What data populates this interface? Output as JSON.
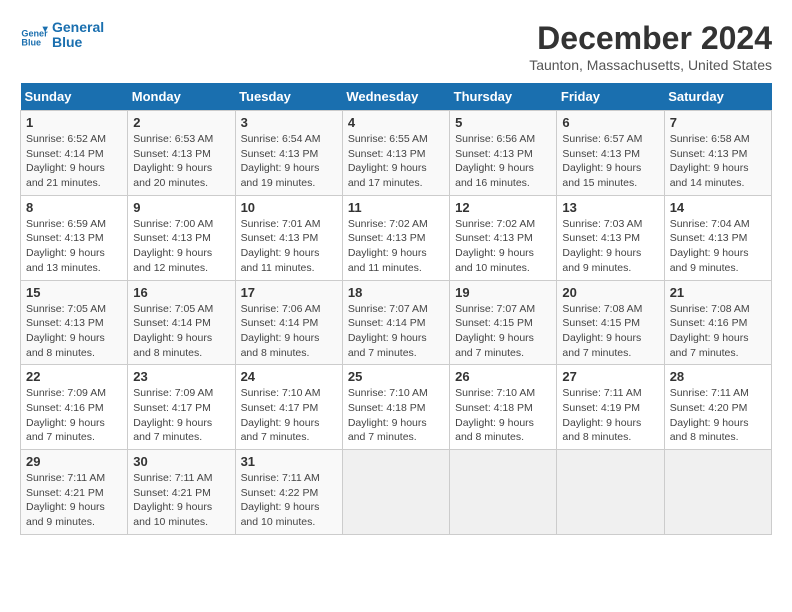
{
  "logo": {
    "line1": "General",
    "line2": "Blue"
  },
  "title": "December 2024",
  "subtitle": "Taunton, Massachusetts, United States",
  "days_of_week": [
    "Sunday",
    "Monday",
    "Tuesday",
    "Wednesday",
    "Thursday",
    "Friday",
    "Saturday"
  ],
  "weeks": [
    [
      {
        "day": "1",
        "sunrise": "6:52 AM",
        "sunset": "4:14 PM",
        "daylight": "9 hours and 21 minutes."
      },
      {
        "day": "2",
        "sunrise": "6:53 AM",
        "sunset": "4:13 PM",
        "daylight": "9 hours and 20 minutes."
      },
      {
        "day": "3",
        "sunrise": "6:54 AM",
        "sunset": "4:13 PM",
        "daylight": "9 hours and 19 minutes."
      },
      {
        "day": "4",
        "sunrise": "6:55 AM",
        "sunset": "4:13 PM",
        "daylight": "9 hours and 17 minutes."
      },
      {
        "day": "5",
        "sunrise": "6:56 AM",
        "sunset": "4:13 PM",
        "daylight": "9 hours and 16 minutes."
      },
      {
        "day": "6",
        "sunrise": "6:57 AM",
        "sunset": "4:13 PM",
        "daylight": "9 hours and 15 minutes."
      },
      {
        "day": "7",
        "sunrise": "6:58 AM",
        "sunset": "4:13 PM",
        "daylight": "9 hours and 14 minutes."
      }
    ],
    [
      {
        "day": "8",
        "sunrise": "6:59 AM",
        "sunset": "4:13 PM",
        "daylight": "9 hours and 13 minutes."
      },
      {
        "day": "9",
        "sunrise": "7:00 AM",
        "sunset": "4:13 PM",
        "daylight": "9 hours and 12 minutes."
      },
      {
        "day": "10",
        "sunrise": "7:01 AM",
        "sunset": "4:13 PM",
        "daylight": "9 hours and 11 minutes."
      },
      {
        "day": "11",
        "sunrise": "7:02 AM",
        "sunset": "4:13 PM",
        "daylight": "9 hours and 11 minutes."
      },
      {
        "day": "12",
        "sunrise": "7:02 AM",
        "sunset": "4:13 PM",
        "daylight": "9 hours and 10 minutes."
      },
      {
        "day": "13",
        "sunrise": "7:03 AM",
        "sunset": "4:13 PM",
        "daylight": "9 hours and 9 minutes."
      },
      {
        "day": "14",
        "sunrise": "7:04 AM",
        "sunset": "4:13 PM",
        "daylight": "9 hours and 9 minutes."
      }
    ],
    [
      {
        "day": "15",
        "sunrise": "7:05 AM",
        "sunset": "4:13 PM",
        "daylight": "9 hours and 8 minutes."
      },
      {
        "day": "16",
        "sunrise": "7:05 AM",
        "sunset": "4:14 PM",
        "daylight": "9 hours and 8 minutes."
      },
      {
        "day": "17",
        "sunrise": "7:06 AM",
        "sunset": "4:14 PM",
        "daylight": "9 hours and 8 minutes."
      },
      {
        "day": "18",
        "sunrise": "7:07 AM",
        "sunset": "4:14 PM",
        "daylight": "9 hours and 7 minutes."
      },
      {
        "day": "19",
        "sunrise": "7:07 AM",
        "sunset": "4:15 PM",
        "daylight": "9 hours and 7 minutes."
      },
      {
        "day": "20",
        "sunrise": "7:08 AM",
        "sunset": "4:15 PM",
        "daylight": "9 hours and 7 minutes."
      },
      {
        "day": "21",
        "sunrise": "7:08 AM",
        "sunset": "4:16 PM",
        "daylight": "9 hours and 7 minutes."
      }
    ],
    [
      {
        "day": "22",
        "sunrise": "7:09 AM",
        "sunset": "4:16 PM",
        "daylight": "9 hours and 7 minutes."
      },
      {
        "day": "23",
        "sunrise": "7:09 AM",
        "sunset": "4:17 PM",
        "daylight": "9 hours and 7 minutes."
      },
      {
        "day": "24",
        "sunrise": "7:10 AM",
        "sunset": "4:17 PM",
        "daylight": "9 hours and 7 minutes."
      },
      {
        "day": "25",
        "sunrise": "7:10 AM",
        "sunset": "4:18 PM",
        "daylight": "9 hours and 7 minutes."
      },
      {
        "day": "26",
        "sunrise": "7:10 AM",
        "sunset": "4:18 PM",
        "daylight": "9 hours and 8 minutes."
      },
      {
        "day": "27",
        "sunrise": "7:11 AM",
        "sunset": "4:19 PM",
        "daylight": "9 hours and 8 minutes."
      },
      {
        "day": "28",
        "sunrise": "7:11 AM",
        "sunset": "4:20 PM",
        "daylight": "9 hours and 8 minutes."
      }
    ],
    [
      {
        "day": "29",
        "sunrise": "7:11 AM",
        "sunset": "4:21 PM",
        "daylight": "9 hours and 9 minutes."
      },
      {
        "day": "30",
        "sunrise": "7:11 AM",
        "sunset": "4:21 PM",
        "daylight": "9 hours and 10 minutes."
      },
      {
        "day": "31",
        "sunrise": "7:11 AM",
        "sunset": "4:22 PM",
        "daylight": "9 hours and 10 minutes."
      },
      null,
      null,
      null,
      null
    ]
  ],
  "labels": {
    "sunrise": "Sunrise:",
    "sunset": "Sunset:",
    "daylight": "Daylight:"
  }
}
